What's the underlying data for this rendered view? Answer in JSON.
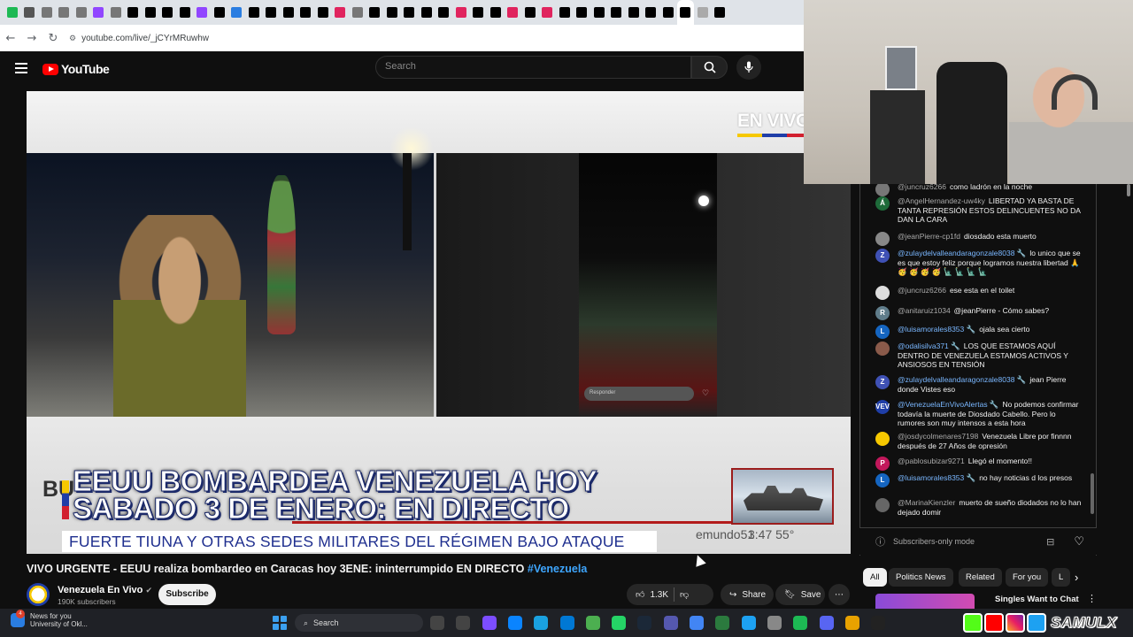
{
  "browser": {
    "url": "youtube.com/live/_jCYrMRuwhw",
    "tab_colors": [
      "#1db954",
      "#555",
      "#777",
      "#777",
      "#777",
      "#9146ff",
      "#777",
      "#000",
      "#000",
      "#000",
      "#000",
      "#9146ff",
      "#000",
      "#2a7de1",
      "#000",
      "#000",
      "#000",
      "#000",
      "#000",
      "#e0245e",
      "#777",
      "#000",
      "#000",
      "#000",
      "#000",
      "#000",
      "#e0245e",
      "#000",
      "#000",
      "#e0245e",
      "#000",
      "#e0245e",
      "#000",
      "#000",
      "#000",
      "#000",
      "#000",
      "#000",
      "#000",
      "#000",
      "#aaa",
      "#000"
    ]
  },
  "youtube": {
    "logo_text": "YouTube",
    "search_placeholder": "Search"
  },
  "video": {
    "overlay_badge": "EN VIVO",
    "headline": "EEUU BOMBARDEA VENEZUELA HOY SABADO 3 DE ENERO: EN DIRECTO",
    "subheadline": "FUERTE TIUNA Y OTRAS SEDES MILITARES DEL RÉGIMEN BAJO ATAQUE",
    "left_fragment": "BU",
    "handle": "emundo51",
    "timecode": "3:47    55°",
    "responder": "Responder",
    "title": "VIVO URGENTE - EEUU realiza bombardeo en Caracas hoy 3ENE: ininterrumpido EN DIRECTO",
    "title_tag": "#Venezuela",
    "channel_name": "Venezuela En Vivo",
    "channel_subs": "190K subscribers",
    "subscribe_label": "Subscribe",
    "likes": "1.3K",
    "share_label": "Share",
    "save_label": "Save"
  },
  "chat": {
    "messages": [
      {
        "author": "@juncruz6266",
        "text": "como ladrón en la noche",
        "color": "#777",
        "initial": "",
        "member": false
      },
      {
        "author": "@AngelHernandez-uw4ky",
        "text": "LIBERTAD YA BASTA DE TANTA REPRESIÓN ESTOS DELINCUENTES NO DA DAN LA CARA",
        "color": "#1e6b3a",
        "initial": "Á",
        "member": false
      },
      {
        "author": "@jeanPierre-cp1fd",
        "text": "diosdado esta muerto",
        "color": "#888",
        "initial": "",
        "member": false
      },
      {
        "author": "@zulaydelvalleandaragonzale8038 🔧",
        "text": "lo unico que se es que estoy feliz porque logramos nuestra libertad 🙏 🥳 🥳 🥳 🥳 🗽 🗽 🗽 🗽",
        "color": "#3f51b5",
        "initial": "Z",
        "member": true
      },
      {
        "author": "@juncruz6266",
        "text": "ese esta en el toilet",
        "color": "#ddd",
        "initial": "",
        "member": false
      },
      {
        "author": "@anitaruiz1034",
        "text": "@jeanPierre - Cómo sabes?",
        "color": "#607d8b",
        "initial": "R",
        "member": false
      },
      {
        "author": "@luisamorales8353 🔧",
        "text": "ojala sea cierto",
        "color": "#1565c0",
        "initial": "L",
        "member": true
      },
      {
        "author": "@odalisilva371 🔧",
        "text": "LOS QUE ESTAMOS AQUÍ DENTRO DE VENEZUELA ESTAMOS ACTIVOS Y ANSIOSOS EN TENSIÓN",
        "color": "#8a5a4a",
        "initial": "",
        "member": true
      },
      {
        "author": "@zulaydelvalleandaragonzale8038 🔧",
        "text": "jean Pierre donde Vistes eso",
        "color": "#3f51b5",
        "initial": "Z",
        "member": true
      },
      {
        "author": "@VenezuelaEnVivoAlertas 🔧",
        "text": "No podemos confirmar todavía la muerte de Diosdado Cabello. Pero lo rumores son muy intensos a esta hora",
        "color": "#1f3ea8",
        "initial": "VEV",
        "member": true
      },
      {
        "author": "@josdycolmenares7198",
        "text": "Venezuela Libre por finnnn después de 27 Años de opresión",
        "color": "#f6c800",
        "initial": "",
        "member": false
      },
      {
        "author": "@pablosubizar9271",
        "text": "Llegó el momento!!",
        "color": "#c2185b",
        "initial": "P",
        "member": false
      },
      {
        "author": "@luisamorales8353 🔧",
        "text": "no hay noticias d los presos",
        "color": "#1565c0",
        "initial": "L",
        "member": true
      },
      {
        "author": "@MarinaKienzler",
        "text": "muerto de sueño diodados no lo han dejado domir",
        "color": "#666",
        "initial": "",
        "member": false
      }
    ],
    "mode_text": "Subscribers-only mode"
  },
  "chips": [
    "All",
    "Politics News",
    "Related",
    "For you",
    "L"
  ],
  "recommendation": {
    "title": "Singles Want to Chat"
  },
  "taskbar": {
    "news_line1": "News for you",
    "news_line2": "University of Okl...",
    "news_badge": "4",
    "search_label": "Search",
    "overlay_name": "SAMULX"
  }
}
